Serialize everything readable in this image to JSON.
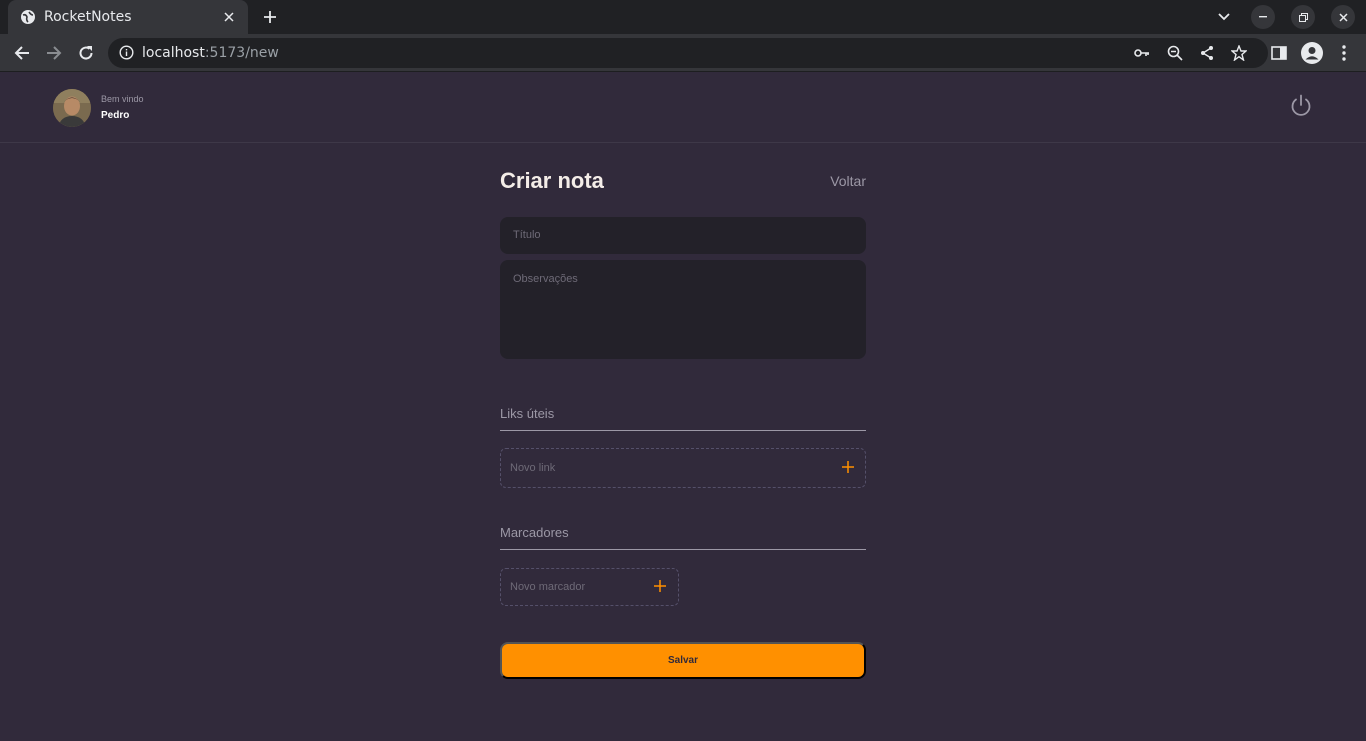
{
  "browser": {
    "tab_title": "RocketNotes",
    "url_host": "localhost",
    "url_rest": ":5173/new"
  },
  "header": {
    "welcome": "Bem vindo",
    "username": "Pedro"
  },
  "form": {
    "title": "Criar nota",
    "back": "Voltar",
    "title_placeholder": "Título",
    "notes_placeholder": "Observações",
    "links_section": "Liks úteis",
    "new_link_placeholder": "Novo link",
    "tags_section": "Marcadores",
    "new_tag_placeholder": "Novo marcador",
    "save": "Salvar"
  },
  "colors": {
    "background": "#312a3b",
    "accent": "#ff9000",
    "input_bg": "#232129"
  }
}
